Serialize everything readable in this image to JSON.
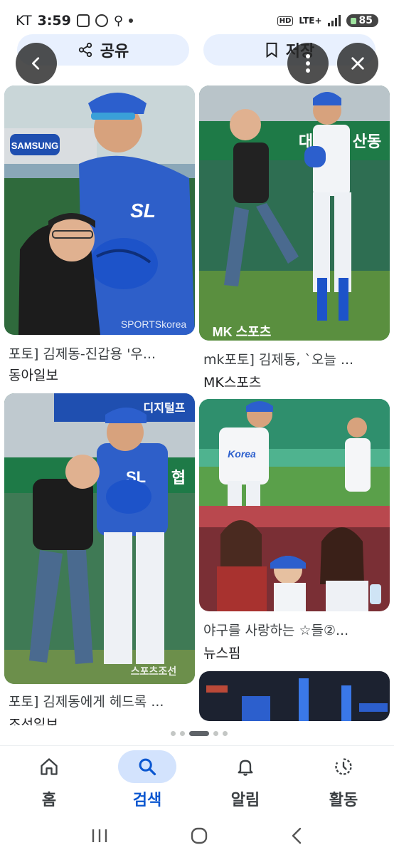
{
  "status_bar": {
    "carrier": "KT",
    "time": "3:59",
    "hd": "HD",
    "network": "LTE+",
    "battery": "85"
  },
  "actions": {
    "share_label": "공유",
    "save_label": "저장"
  },
  "results": [
    {
      "title": "포토] 김제동-진갑용 '우...",
      "source": "동아일보"
    },
    {
      "title": "mk포토] 김제동, `오늘 ...",
      "source": "MK스포츠"
    },
    {
      "title": "포토] 김제동에게 헤드록 ...",
      "source": "조선일보"
    },
    {
      "title": "야구를 사랑하는 ☆들②...",
      "source": "뉴스핌"
    }
  ],
  "image_text": {
    "watermark_1": "SPORTSkorea",
    "watermark_2": "MK 스포츠",
    "watermark_3": "스포츠조선",
    "sign_samsung": "SAMSUNG",
    "sign_daegu": "대",
    "sign_daegu_2": "산동",
    "sign_digital": "디지털프",
    "sign_hyup": "협",
    "jersey_sl": "SL",
    "jersey_korea": "Korea"
  },
  "bottom_nav": [
    {
      "label": "홈",
      "icon": "home-icon"
    },
    {
      "label": "검색",
      "icon": "search-icon",
      "active": true
    },
    {
      "label": "알림",
      "icon": "bell-icon"
    },
    {
      "label": "활동",
      "icon": "activity-icon"
    }
  ],
  "colors": {
    "accent": "#0b57d0",
    "active_pill": "#d3e3fd",
    "action_pill": "#e8f0fe",
    "samsung_blue": "#1f4fb0"
  }
}
